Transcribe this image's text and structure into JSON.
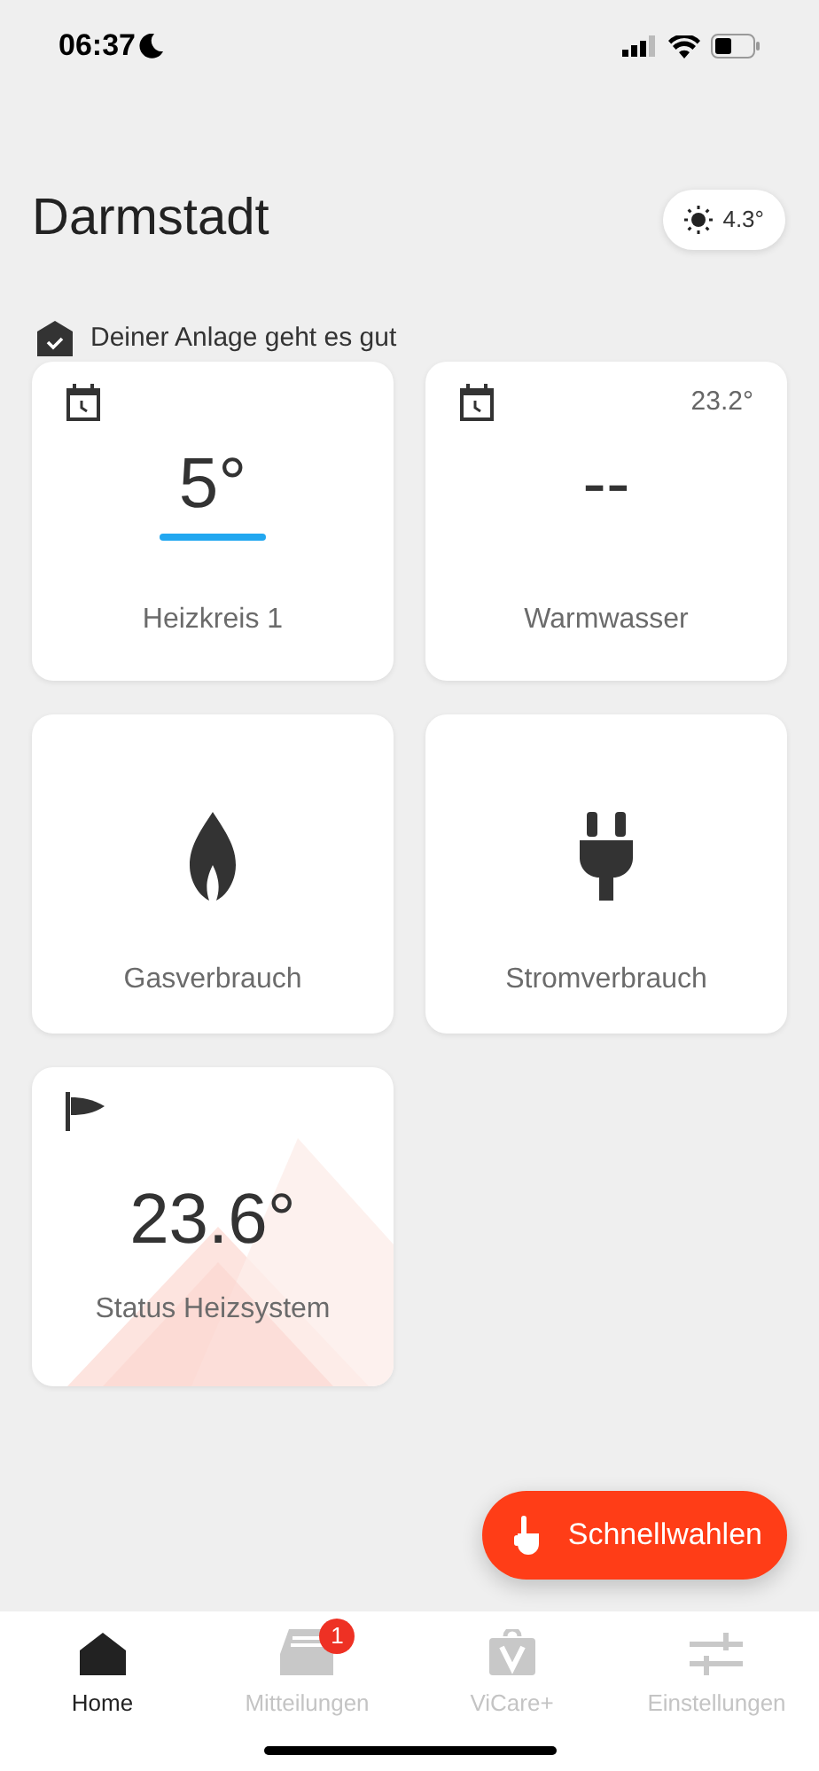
{
  "status_bar": {
    "time": "06:37"
  },
  "header": {
    "title": "Darmstadt",
    "weather": "4.3°"
  },
  "system_status": "Deiner Anlage geht es gut",
  "tiles": [
    {
      "kind": "circuit",
      "label": "Heizkreis 1",
      "value": "5°",
      "heating": true
    },
    {
      "kind": "circuit",
      "label": "Warmwasser",
      "value": "--",
      "reading": "23.2°",
      "heating": false
    },
    {
      "kind": "gas",
      "label": "Gasverbrauch"
    },
    {
      "kind": "power",
      "label": "Stromverbrauch"
    },
    {
      "kind": "status",
      "label": "Status Heizsystem",
      "value": "23.6°"
    }
  ],
  "fab": {
    "label": "Schnellwahlen"
  },
  "nav": [
    {
      "kind": "home",
      "label": "Home",
      "selected": true
    },
    {
      "kind": "messages",
      "label": "Mitteilungen",
      "selected": false,
      "badge": "1"
    },
    {
      "kind": "shop",
      "label": "ViCare+",
      "selected": false
    },
    {
      "kind": "settings",
      "label": "Einstellungen",
      "selected": false
    }
  ]
}
